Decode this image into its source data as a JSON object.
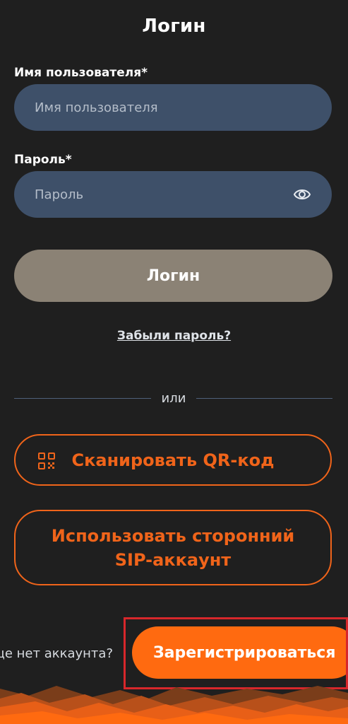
{
  "page": {
    "title": "Логин"
  },
  "form": {
    "username_label": "Имя пользователя*",
    "username_placeholder": "Имя пользователя",
    "password_label": "Пароль*",
    "password_placeholder": "Пароль",
    "password_toggle_icon": "eye-icon",
    "login_button": "Логин",
    "forgot_password": "Забыли пароль?"
  },
  "divider": {
    "text": "или"
  },
  "alt_actions": {
    "scan_qr": "Сканировать QR-код",
    "scan_qr_icon": "qr-code-icon",
    "third_party_sip_line1": "Использовать сторонний",
    "third_party_sip_line2": "SIP-аккаунт"
  },
  "footer": {
    "no_account_text": "Еще нет аккаунта?",
    "register_button": "Зарегистрироваться"
  },
  "colors": {
    "background": "#1f1f1f",
    "field": "#3e5069",
    "login_button": "#8b8275",
    "accent": "#f0641a",
    "register": "#ff6a10",
    "highlight": "#d7272b"
  }
}
